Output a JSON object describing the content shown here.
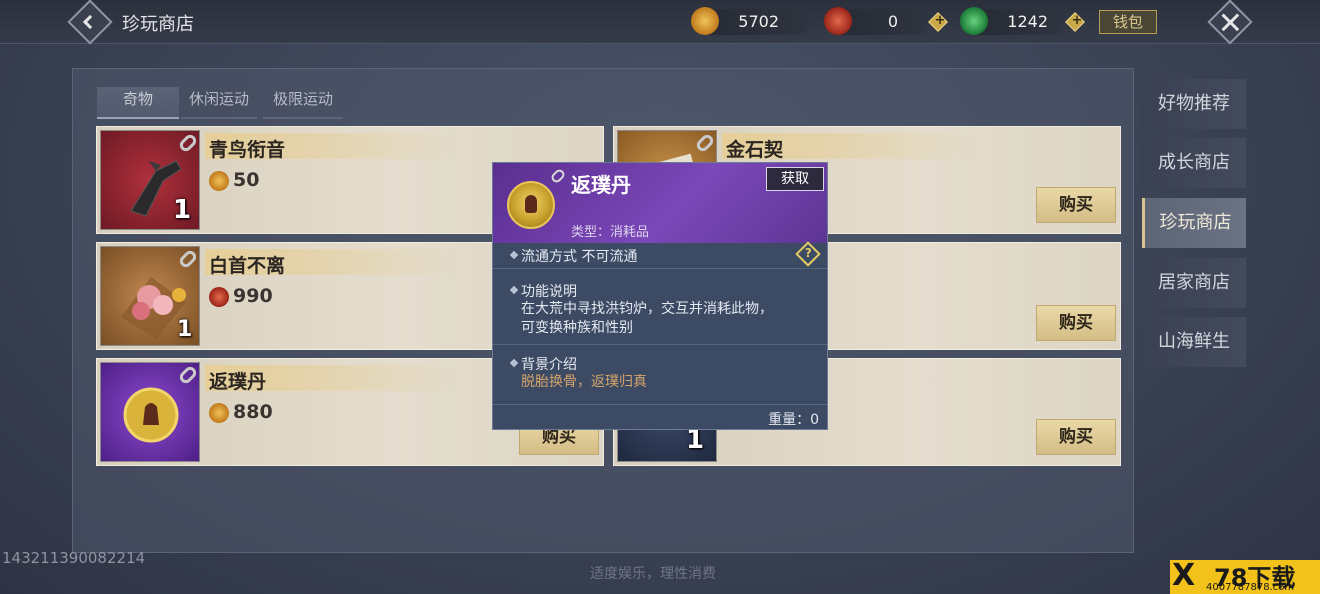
{
  "header": {
    "title": "珍玩商店",
    "currencies": [
      {
        "name": "gold-coin",
        "value": "5702",
        "color": "#d99a2b"
      },
      {
        "name": "red-token",
        "value": "0",
        "color": "#c23a28"
      },
      {
        "name": "jade-token",
        "value": "1242",
        "color": "#2aa34a"
      }
    ],
    "bag_label": "钱包"
  },
  "tabs": [
    {
      "label": "奇物",
      "active": true
    },
    {
      "label": "休闲运动",
      "active": false
    },
    {
      "label": "极限运动",
      "active": false
    }
  ],
  "items": [
    {
      "name": "青鸟衔音",
      "price": "50",
      "currency": "gold-coin",
      "qty": "1"
    },
    {
      "name": "金石契",
      "price": "",
      "currency": "",
      "qty": "",
      "buy": "购买"
    },
    {
      "name": "白首不离",
      "price": "990",
      "currency": "red-token",
      "qty": "1"
    },
    {
      "name": "",
      "price": "",
      "currency": "",
      "qty": "",
      "buy": "购买"
    },
    {
      "name": "返璞丹",
      "price": "880",
      "currency": "gold-coin",
      "qty": "",
      "buy": "购买"
    },
    {
      "name": "",
      "price": "",
      "currency": "",
      "qty": "1",
      "buy": "购买"
    }
  ],
  "sidebar": {
    "items": [
      {
        "label": "好物推荐",
        "active": false
      },
      {
        "label": "成长商店",
        "active": false
      },
      {
        "label": "珍玩商店",
        "active": true
      },
      {
        "label": "居家商店",
        "active": false
      },
      {
        "label": "山海鲜生",
        "active": false
      }
    ]
  },
  "popup": {
    "title": "返璞丹",
    "get_label": "获取",
    "type_text": "类型：消耗品",
    "circulation": "流通方式   不可流通",
    "func_label": "功能说明",
    "func_text_1": "在大荒中寻找洪钧炉，交互并消耗此物，",
    "func_text_2": "可变换种族和性别",
    "bg_label": "背景介绍",
    "bg_text": "脱胎换骨，返璞归真",
    "weight": "重量：0",
    "help_glyph": "?"
  },
  "footer": {
    "note": "适度娱乐，理性消费",
    "id_text": "143211390082214"
  },
  "watermark": {
    "main": "78下载",
    "url": "4007787878.com"
  }
}
